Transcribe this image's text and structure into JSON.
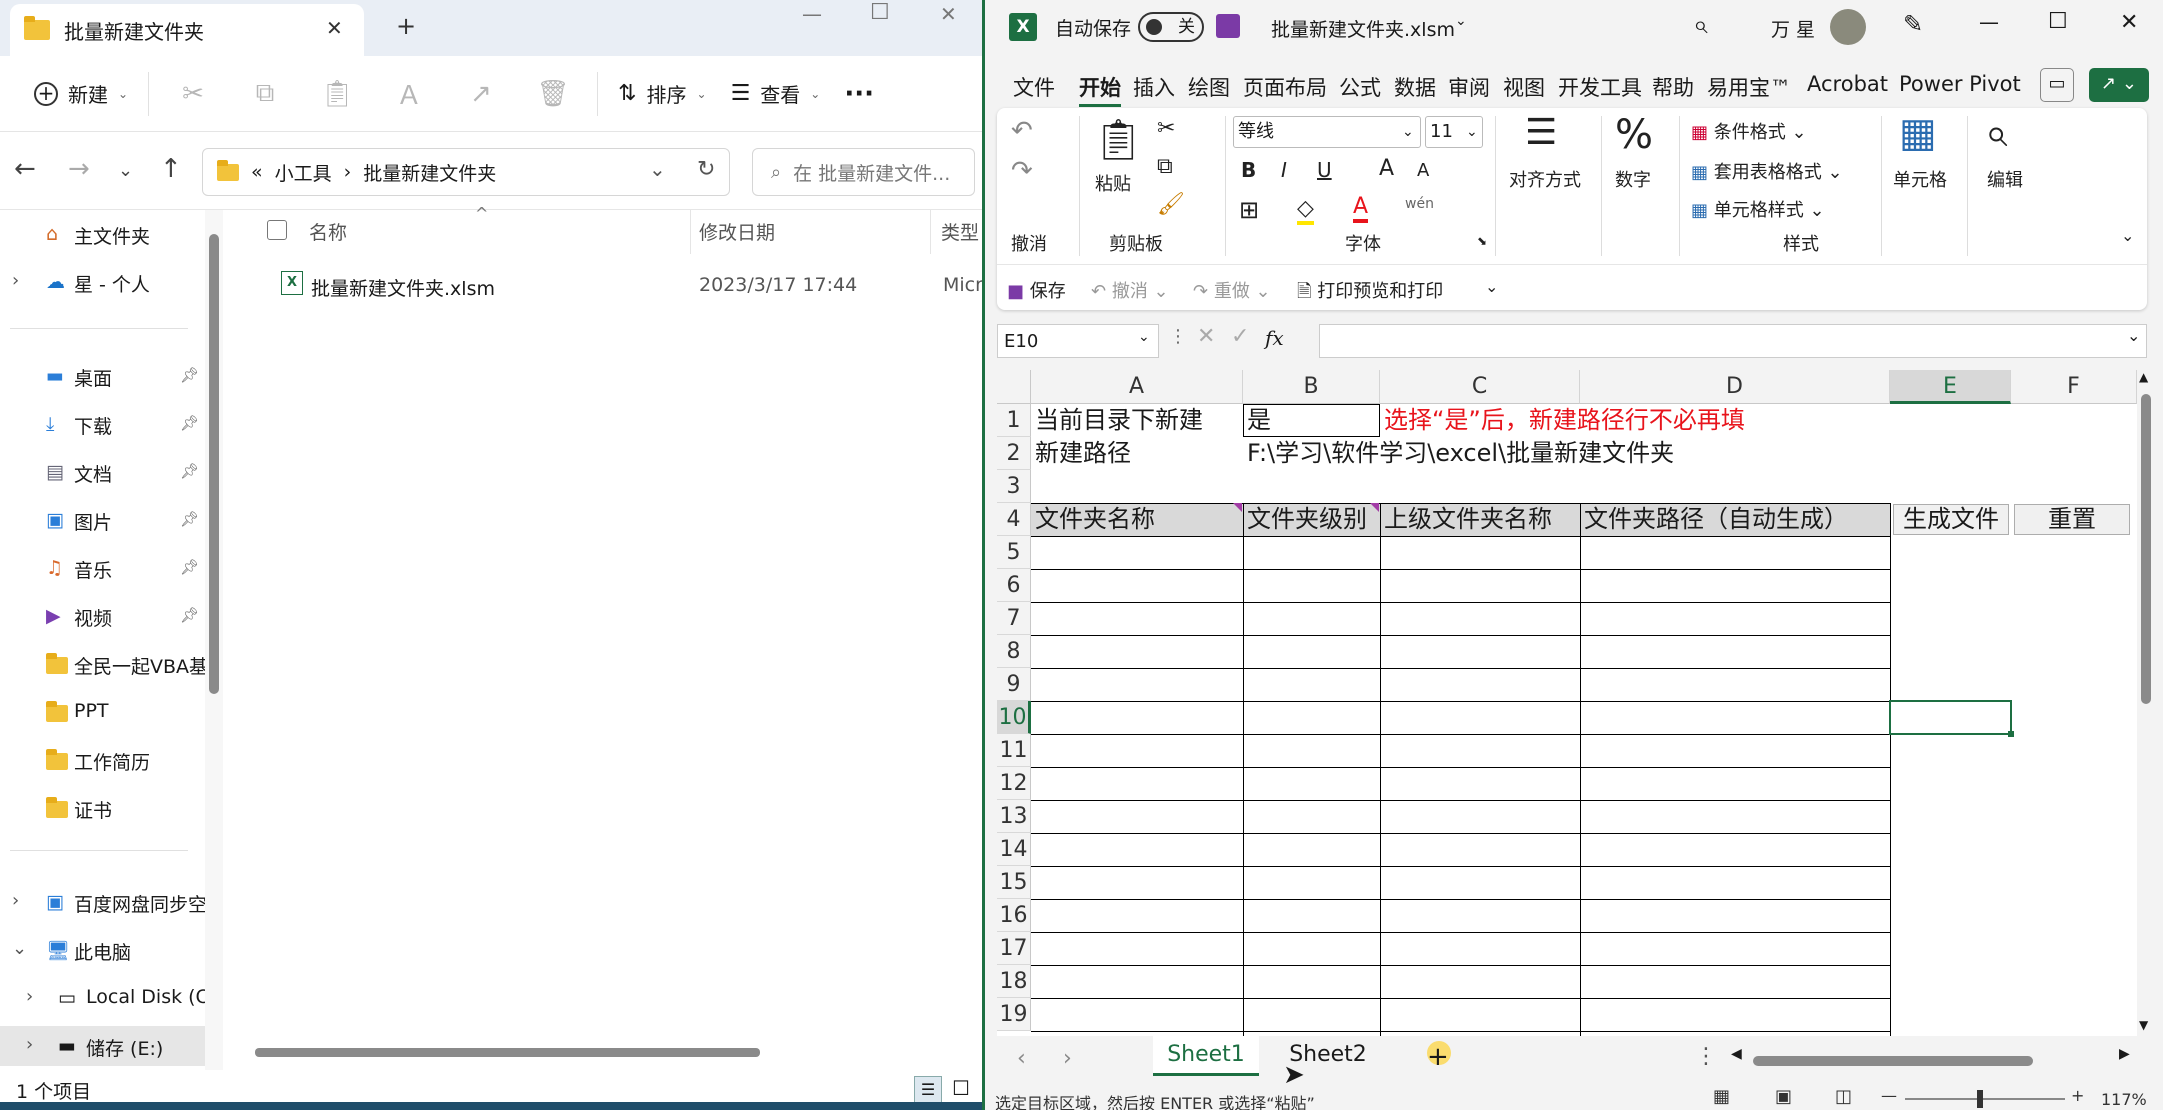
{
  "explorer": {
    "tab_title": "批量新建文件夹",
    "new_tab": "+",
    "window_controls": {
      "minimize": "—",
      "maximize": "☐",
      "close": "✕"
    },
    "toolbar": {
      "new_label": "新建",
      "sort_label": "排序",
      "view_label": "查看",
      "more": "···"
    },
    "breadcrumb": {
      "overflow": "«",
      "items": [
        "小工具",
        "批量新建文件夹"
      ],
      "sep": "›"
    },
    "search_placeholder": "在 批量新建文件...",
    "sidebar": {
      "home": "主文件夹",
      "personal": "星 - 个人",
      "quick": [
        {
          "label": "桌面"
        },
        {
          "label": "下载"
        },
        {
          "label": "文档"
        },
        {
          "label": "图片"
        },
        {
          "label": "音乐"
        },
        {
          "label": "视频"
        },
        {
          "label": "全民一起VBA基"
        },
        {
          "label": "PPT"
        },
        {
          "label": "工作简历"
        },
        {
          "label": "证书"
        }
      ],
      "baidu": "百度网盘同步空",
      "thispc": "此电脑",
      "local_disk": "Local Disk (C",
      "storage": "储存 (E:)"
    },
    "columns": {
      "name": "名称",
      "modified": "修改日期",
      "type": "类型"
    },
    "file": {
      "name": "批量新建文件夹.xlsm",
      "modified": "2023/3/17 17:44",
      "type": "Micr"
    },
    "status": "1 个项目"
  },
  "excel": {
    "autosave_label": "自动保存",
    "autosave_state": "关",
    "filename": "批量新建文件夹.xlsm",
    "user": "万 星",
    "menu": [
      "文件",
      "开始",
      "插入",
      "绘图",
      "页面布局",
      "公式",
      "数据",
      "审阅",
      "视图",
      "开发工具",
      "帮助",
      "易用宝™",
      "Acrobat",
      "Power Pivot"
    ],
    "ribbon": {
      "paste": "粘贴",
      "font_name": "等线",
      "font_size": "11",
      "bold": "B",
      "italic": "I",
      "underline": "U",
      "align": "对齐方式",
      "number": "数字",
      "cond_format": "条件格式",
      "table_format": "套用表格格式",
      "cell_style": "单元格样式",
      "cells": "单元格",
      "edit": "编辑",
      "groups": {
        "undo": "撤消",
        "clipboard": "剪贴板",
        "font": "字体",
        "styles": "样式"
      },
      "qat_save": "保存",
      "qat_undo": "撤消",
      "qat_redo": "重做",
      "qat_print": "打印预览和打印"
    },
    "name_box": "E10",
    "fx": "fx",
    "columns": [
      "A",
      "B",
      "C",
      "D",
      "E",
      "F"
    ],
    "rows": [
      "1",
      "2",
      "3",
      "4",
      "5",
      "6",
      "7",
      "8",
      "9",
      "10",
      "11",
      "12",
      "13",
      "14",
      "15",
      "16",
      "17",
      "18",
      "19"
    ],
    "cells": {
      "A1": "当前目录下新建",
      "B1": "是",
      "C1": "选择“是”后，新建路径行不必再填",
      "A2": "新建路径",
      "B2": "F:\\学习\\软件学习\\excel\\批量新建文件夹",
      "A4": "文件夹名称",
      "B4": "文件夹级别",
      "C4": "上级文件夹名称",
      "D4": "文件夹路径（自动生成）",
      "E4": "生成文件",
      "F4": "重置"
    },
    "sheets": [
      "Sheet1",
      "Sheet2"
    ],
    "add_sheet": "+",
    "status_text": "选定目标区域，然后按 ENTER 或选择“粘贴”",
    "zoom": "117%",
    "colors": {
      "accent": "#1d6f42",
      "red_text": "#e8141c",
      "header_fill": "#d9d9d9"
    }
  }
}
